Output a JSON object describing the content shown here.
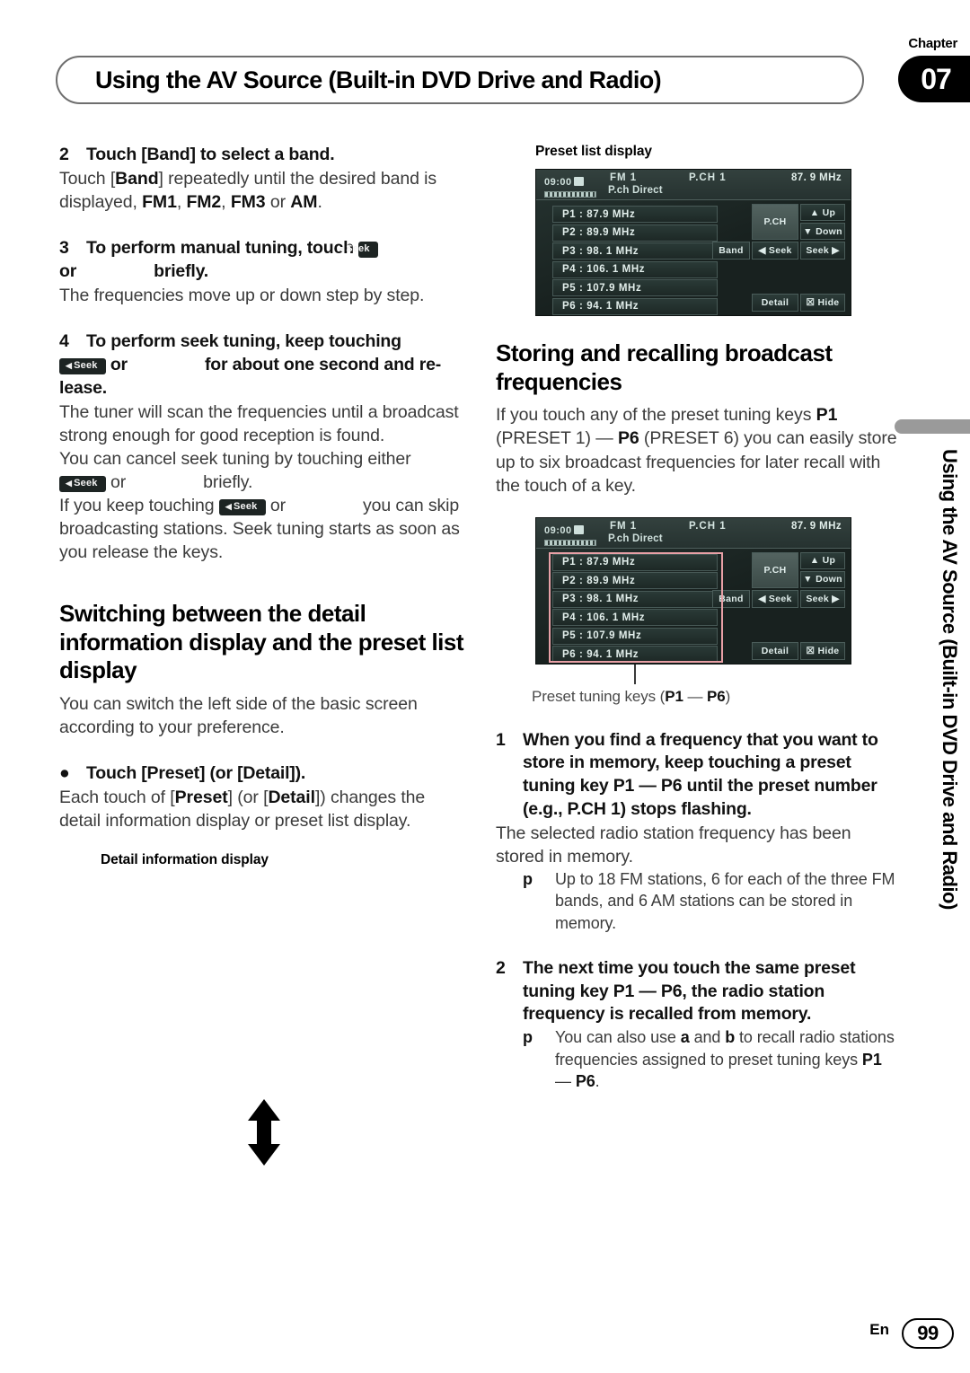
{
  "header": {
    "chapter_label": "Chapter",
    "chapter_number": "07",
    "title": "Using the AV Source (Built-in DVD Drive and Radio)"
  },
  "sidebar": {
    "running_head": "Using the AV Source (Built-in DVD Drive and Radio)"
  },
  "footer": {
    "language": "En",
    "page_number": "99"
  },
  "left_column": {
    "step2_head_num": "2",
    "step2_head": "Touch [Band] to select a band.",
    "step2_body_a": "Touch [",
    "step2_body_band": "Band",
    "step2_body_b": "] repeatedly until the desired band is displayed, ",
    "step2_fm1": "FM1",
    "step2_fm2": "FM2",
    "step2_fm3": "FM3",
    "step2_or": " or ",
    "step2_am": "AM",
    "step2_period": ".",
    "step3_head_num": "3",
    "step3_head_a": "To perform manual tuning, touch ",
    "step3_head_or": "or",
    "step3_head_b": "briefly.",
    "step3_body": "The frequencies move up or down step by step.",
    "step4_head_num": "4",
    "step4_head_a": "To perform seek tuning, keep touching",
    "step4_head_or": "or",
    "step4_head_b": "for about one second and re-",
    "step4_head_c": "lease.",
    "step4_body1": "The tuner will scan the frequencies until a broadcast strong enough for good reception is found.",
    "step4_body2": "You can cancel seek tuning by touching either",
    "step4_body2_or": "or",
    "step4_body2_end": "briefly.",
    "step4_body3_a": "If you keep touching",
    "step4_body3_or": "or",
    "step4_body3_b": "you can skip broadcasting stations. Seek tuning starts as soon as you release the keys.",
    "h2_switching": "Switching between the detail information display and the preset list display",
    "switching_body": "You can switch the left side of the basic screen according to your preference.",
    "bullet_dot": "●",
    "bullet_head": "Touch [Preset] (or [Detail]).",
    "bullet_body_a": "Each touch of [",
    "bullet_body_preset": "Preset",
    "bullet_body_b": "] (or [",
    "bullet_body_detail": "Detail",
    "bullet_body_c": "]) changes the detail information display or preset list display.",
    "detail_caption": "Detail information display"
  },
  "right_column": {
    "preset_list_caption": "Preset list display",
    "h2_storing": "Storing and recalling broadcast frequencies",
    "storing_body_a": "If you touch any of the preset tuning keys ",
    "storing_p1": "P1",
    "storing_body_b": " (PRESET 1) — ",
    "storing_p6": "P6",
    "storing_body_c": " (PRESET 6) you can easily store up to six broadcast frequencies for later recall with the touch of a key.",
    "preset_keys_caption_a": "Preset tuning keys (",
    "preset_keys_caption_p1": "P1",
    "preset_keys_caption_dash": " — ",
    "preset_keys_caption_p6": "P6",
    "preset_keys_caption_b": ")",
    "step1_num": "1",
    "step1_head": "When you find a frequency that you want to store in memory, keep touching a preset tuning key P1 — P6 until the preset number (e.g., P.CH 1) stops flashing.",
    "step1_body": "The selected radio station frequency has been stored in memory.",
    "step1_note_mark": "p",
    "step1_note": "Up to 18 FM stations, 6 for each of the three FM bands, and 6 AM stations can be stored in memory.",
    "step2_num": "2",
    "step2_head": "The next time you touch the same preset tuning key P1 — P6, the radio station frequency is recalled from memory.",
    "step2_note_mark": "p",
    "step2_note_a": "You can also use ",
    "step2_note_a_key": "a",
    "step2_note_and": " and ",
    "step2_note_b_key": "b",
    "step2_note_b": " to recall radio stations frequencies assigned to preset tuning keys ",
    "step2_note_p1": "P1",
    "step2_note_dash": " — ",
    "step2_note_p6": "P6",
    "step2_note_end": "."
  },
  "seek_key": {
    "left_label": "Seek",
    "left_triangle": "◀",
    "right_label": "Seek",
    "right_triangle": "▶"
  },
  "stereo_screen": {
    "clock": "09:00",
    "band": "FM   1",
    "pch": "P.CH   1",
    "frequency": "87. 9 MHz",
    "direct_label": "P.ch Direct",
    "presets": [
      "P1 :  87.9  MHz",
      "P2 :  89.9  MHz",
      "P3 :  98. 1  MHz",
      "P4 : 106. 1  MHz",
      "P5 : 107.9  MHz",
      "P6 :  94. 1  MHz"
    ],
    "buttons": {
      "pch": "P.CH",
      "up": "▲ Up",
      "down": "▼ Down",
      "band": "Band",
      "seek_left": "◀ Seek",
      "seek_right": "Seek ▶",
      "detail": "Detail",
      "hide": "☒ Hide"
    }
  },
  "colors": {
    "screen_bg": "#18211f",
    "screen_top": "#33413e",
    "screen_text": "#dfecea",
    "highlight_box": "#e8a0a6",
    "chapter_tab": "#000000",
    "side_tab": "#9a9a9a"
  }
}
